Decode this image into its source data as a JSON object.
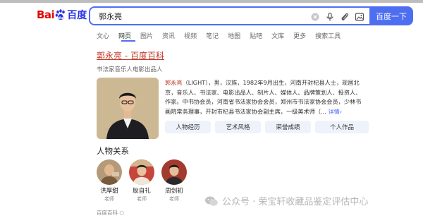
{
  "logo": {
    "part1": "Bai",
    "part2": "百度"
  },
  "search": {
    "query": "郭永亮",
    "button_label": "百度一下"
  },
  "tabs": [
    "文心",
    "网页",
    "图片",
    "资讯",
    "视频",
    "笔记",
    "地图",
    "贴吧",
    "文库",
    "更多",
    "搜索工具"
  ],
  "result": {
    "title": "郭永亮 - 百度百科",
    "subtitle": "书法家音乐人电影出品人",
    "desc_name": "郭永亮",
    "desc_line1_rest": "（LIGHT），男，汉族，1982年9月出生，河南开封杞县人士，现居北",
    "desc_line2": "京，音乐人、书法家、电影出品人、制片人、媒体人、品牌策划人、投资人、",
    "desc_line3": "作家。中书协会员，河南省书法家协会会员，郑州市书法家协会会员，少林书",
    "desc_line4": "画院常务理事，开封市杞县书法家协会副主席，一级美术师（...",
    "desc_more": "详情",
    "chips": [
      "人物经历",
      "艺术风格",
      "荣誉成绩",
      "个人作品"
    ]
  },
  "relations": {
    "title": "人物关系",
    "people": [
      {
        "name": "洪厚甜",
        "role": "老师"
      },
      {
        "name": "耿自礼",
        "role": "老师"
      },
      {
        "name": "周剑初",
        "role": "老师"
      }
    ]
  },
  "source": "百度百科",
  "watermark": "公众号 · 荣宝轩收藏品鉴定评估中心",
  "colors": {
    "accent": "#4e6ef2",
    "title_red": "#c0392b",
    "logo_red": "#e10602",
    "logo_blue": "#2932e1"
  }
}
